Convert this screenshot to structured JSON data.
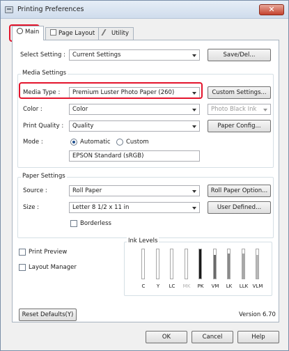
{
  "window": {
    "title": "Printing Preferences",
    "close_glyph": "✕"
  },
  "tabs": [
    {
      "label": "Main",
      "icon": "printer-icon"
    },
    {
      "label": "Page Layout",
      "icon": "page-layout-icon"
    },
    {
      "label": "Utility",
      "icon": "utility-icon"
    }
  ],
  "select_setting": {
    "label": "Select Setting :",
    "value": "Current Settings",
    "save_button": "Save/Del..."
  },
  "media_settings": {
    "group_title": "Media Settings",
    "media_type": {
      "label": "Media Type :",
      "value": "Premium Luster Photo Paper (260)",
      "button": "Custom Settings..."
    },
    "color": {
      "label": "Color :",
      "value": "Color",
      "ink": "Photo Black Ink"
    },
    "print_quality": {
      "label": "Print Quality :",
      "value": "Quality",
      "button": "Paper Config..."
    },
    "mode": {
      "label": "Mode :",
      "automatic": "Automatic",
      "custom": "Custom",
      "selected": "Automatic",
      "profile": "EPSON Standard (sRGB)"
    }
  },
  "paper_settings": {
    "group_title": "Paper Settings",
    "source": {
      "label": "Source :",
      "value": "Roll Paper",
      "button": "Roll Paper Option..."
    },
    "size": {
      "label": "Size :",
      "value": "Letter 8 1/2 x 11 in",
      "button": "User Defined..."
    },
    "borderless": {
      "label": "Borderless",
      "checked": false
    }
  },
  "options": {
    "print_preview": {
      "label": "Print Preview",
      "checked": false
    },
    "layout_manager": {
      "label": "Layout Manager",
      "checked": false
    }
  },
  "ink_levels": {
    "title": "Ink Levels",
    "inks": [
      {
        "name": "C",
        "level": 0,
        "color": "#ffffff",
        "dim": false
      },
      {
        "name": "Y",
        "level": 0,
        "color": "#ffffff",
        "dim": false
      },
      {
        "name": "LC",
        "level": 0,
        "color": "#ffffff",
        "dim": false
      },
      {
        "name": "MK",
        "level": 0,
        "color": "#ffffff",
        "dim": true
      },
      {
        "name": "PK",
        "level": 1.0,
        "color": "#1a1a1a",
        "dim": false
      },
      {
        "name": "VM",
        "level": 0.8,
        "color": "#6a6a6a",
        "dim": false
      },
      {
        "name": "LK",
        "level": 0.85,
        "color": "#8a8a8a",
        "dim": false
      },
      {
        "name": "LLK",
        "level": 0.85,
        "color": "#a8a8a8",
        "dim": false
      },
      {
        "name": "VLM",
        "level": 0.8,
        "color": "#b8b8b8",
        "dim": false
      }
    ]
  },
  "footer": {
    "reset_button": "Reset Defaults(Y)",
    "version": "Version 6.70"
  },
  "dialog_buttons": {
    "ok": "OK",
    "cancel": "Cancel",
    "help": "Help"
  }
}
